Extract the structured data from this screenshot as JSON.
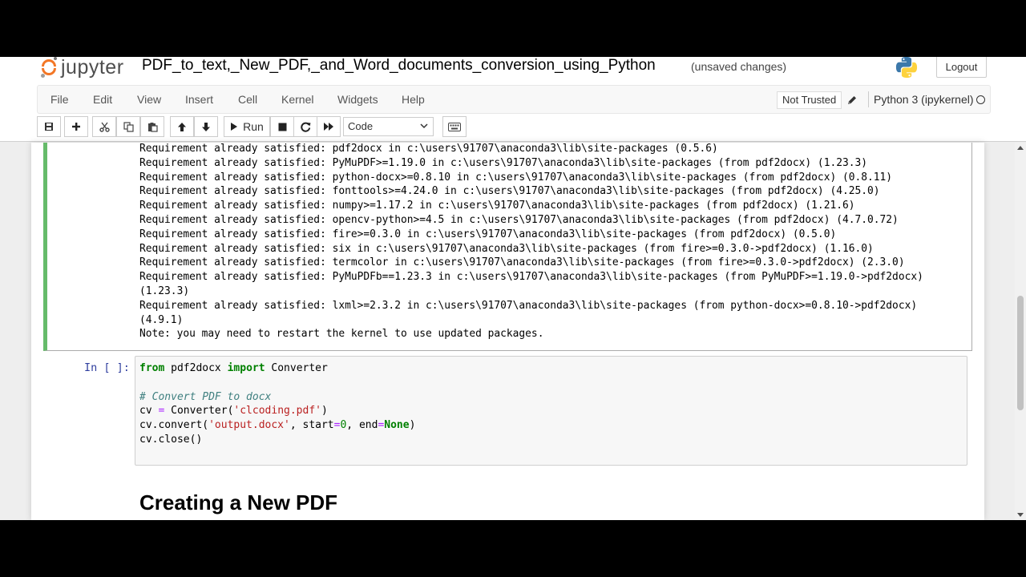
{
  "header": {
    "logo_text": "jupyter",
    "notebook_title": "PDF_to_text,_New_PDF,_and_Word_documents_conversion_using_Python",
    "save_status": "(unsaved changes)",
    "logout_label": "Logout"
  },
  "menubar": {
    "items": [
      "File",
      "Edit",
      "View",
      "Insert",
      "Cell",
      "Kernel",
      "Widgets",
      "Help"
    ],
    "trust_status": "Not Trusted",
    "kernel_name": "Python 3 (ipykernel)"
  },
  "toolbar": {
    "run_label": "Run",
    "cell_type": "Code",
    "buttons": [
      "save-icon",
      "plus-icon",
      "cut-icon",
      "copy-icon",
      "paste-icon",
      "arrow-up-icon",
      "arrow-down-icon",
      "play-icon",
      "stop-icon",
      "restart-icon",
      "fast-forward-icon",
      "keyboard-icon"
    ]
  },
  "output_cell": {
    "lines": [
      "Requirement already satisfied: pdf2docx in c:\\users\\91707\\anaconda3\\lib\\site-packages (0.5.6)",
      "Requirement already satisfied: PyMuPDF>=1.19.0 in c:\\users\\91707\\anaconda3\\lib\\site-packages (from pdf2docx) (1.23.3)",
      "Requirement already satisfied: python-docx>=0.8.10 in c:\\users\\91707\\anaconda3\\lib\\site-packages (from pdf2docx) (0.8.11)",
      "Requirement already satisfied: fonttools>=4.24.0 in c:\\users\\91707\\anaconda3\\lib\\site-packages (from pdf2docx) (4.25.0)",
      "Requirement already satisfied: numpy>=1.17.2 in c:\\users\\91707\\anaconda3\\lib\\site-packages (from pdf2docx) (1.21.6)",
      "Requirement already satisfied: opencv-python>=4.5 in c:\\users\\91707\\anaconda3\\lib\\site-packages (from pdf2docx) (4.7.0.72)",
      "Requirement already satisfied: fire>=0.3.0 in c:\\users\\91707\\anaconda3\\lib\\site-packages (from pdf2docx) (0.5.0)",
      "Requirement already satisfied: six in c:\\users\\91707\\anaconda3\\lib\\site-packages (from fire>=0.3.0->pdf2docx) (1.16.0)",
      "Requirement already satisfied: termcolor in c:\\users\\91707\\anaconda3\\lib\\site-packages (from fire>=0.3.0->pdf2docx) (2.3.0)",
      "Requirement already satisfied: PyMuPDFb==1.23.3 in c:\\users\\91707\\anaconda3\\lib\\site-packages (from PyMuPDF>=1.19.0->pdf2docx)",
      "(1.23.3)",
      "Requirement already satisfied: lxml>=2.3.2 in c:\\users\\91707\\anaconda3\\lib\\site-packages (from python-docx>=0.8.10->pdf2docx)",
      "(4.9.1)",
      "Note: you may need to restart the kernel to use updated packages."
    ]
  },
  "code_cell": {
    "prompt": "In [ ]:",
    "line1_kw1": "from",
    "line1_mod": " pdf2docx ",
    "line1_kw2": "import",
    "line1_name": " Converter",
    "comment": "# Convert PDF to docx",
    "line3_a": "cv ",
    "line3_op": "=",
    "line3_b": " Converter(",
    "line3_str": "'clcoding.pdf'",
    "line3_c": ")",
    "line4_a": "cv.convert(",
    "line4_str": "'output.docx'",
    "line4_b": ", start",
    "line4_op1": "=",
    "line4_num": "0",
    "line4_c": ", end",
    "line4_op2": "=",
    "line4_none": "None",
    "line4_d": ")",
    "line5": "cv.close()"
  },
  "markdown": {
    "heading": "Creating a New PDF"
  }
}
